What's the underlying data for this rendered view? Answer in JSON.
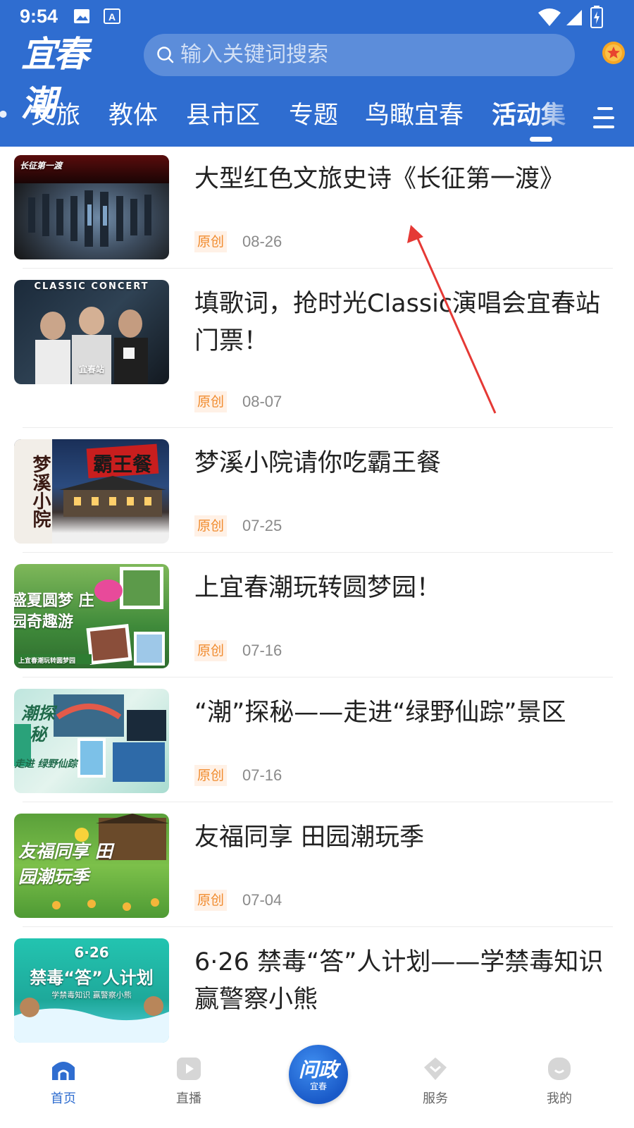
{
  "status": {
    "time": "9:54"
  },
  "header": {
    "logo": "宜春潮",
    "search_placeholder": "输入关键词搜索",
    "tabs": [
      {
        "label": "文旅"
      },
      {
        "label": "教体"
      },
      {
        "label": "县市区"
      },
      {
        "label": "专题"
      },
      {
        "label": "鸟瞰宜春"
      },
      {
        "label": "活动集"
      }
    ],
    "active_tab": "活动集",
    "accent_color": "#2f6dd0"
  },
  "articles": [
    {
      "title": "大型红色文旅史诗《长征第一渡》",
      "badge": "原创",
      "date": "08-26",
      "thumb_text": "长征第一渡"
    },
    {
      "title": "填歌词，抢时光Classic演唱会宜春站门票！",
      "badge": "原创",
      "date": "08-07",
      "thumb_text": "CLASSIC CONCERT",
      "thumb_sub": "宜春站"
    },
    {
      "title": "梦溪小院请你吃霸王餐",
      "badge": "原创",
      "date": "07-25",
      "thumb_text": "霸王餐",
      "thumb_sub": "梦溪小院"
    },
    {
      "title": "上宜春潮玩转圆梦园！",
      "badge": "原创",
      "date": "07-16",
      "thumb_text": "盛夏圆梦 庄园奇趣游",
      "thumb_sub": "上宜春潮玩转圆梦园"
    },
    {
      "title": "“潮”探秘——走进“绿野仙踪”景区",
      "badge": "原创",
      "date": "07-16",
      "thumb_text": "潮探秘",
      "thumb_sub": "走进 绿野仙踪"
    },
    {
      "title": "友福同享 田园潮玩季",
      "badge": "原创",
      "date": "07-04",
      "thumb_text": "友福同享 田园潮玩季"
    },
    {
      "title": "6·26 禁毒“答”人计划——学禁毒知识 赢警察小熊",
      "badge": "",
      "date": "",
      "thumb_text": "6·26",
      "thumb_sub": "禁毒“答”人计划",
      "thumb_sub2": "学禁毒知识 赢警察小熊"
    }
  ],
  "bottom_nav": {
    "items": [
      {
        "label": "首页",
        "icon": "home-icon",
        "active": true
      },
      {
        "label": "直播",
        "icon": "play-icon"
      },
      {
        "label": "服务",
        "icon": "service-icon"
      },
      {
        "label": "我的",
        "icon": "profile-icon"
      }
    ],
    "center": {
      "text": "问政",
      "sub": "宜春"
    }
  }
}
